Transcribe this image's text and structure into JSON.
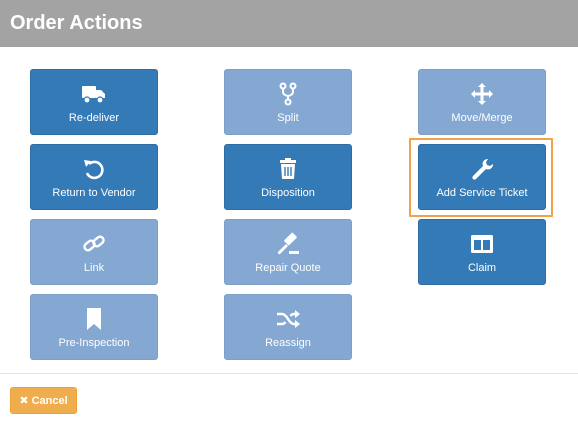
{
  "dialog": {
    "title": "Order Actions"
  },
  "colors": {
    "primary": "#337ab7",
    "primary_disabled": "#84a8d1",
    "warning": "#f0ad4e",
    "highlight": "#f0a24a",
    "header": "#a3a3a3"
  },
  "actions": [
    {
      "label": "Re-deliver",
      "icon": "truck-icon",
      "enabled": true
    },
    {
      "label": "Split",
      "icon": "code-fork-icon",
      "enabled": false
    },
    {
      "label": "Move/Merge",
      "icon": "move-arrows-icon",
      "enabled": false
    },
    {
      "label": "Return to Vendor",
      "icon": "undo-icon",
      "enabled": true
    },
    {
      "label": "Disposition",
      "icon": "trash-icon",
      "enabled": true
    },
    {
      "label": "Add Service Ticket",
      "icon": "wrench-icon",
      "enabled": true,
      "highlighted": true
    },
    {
      "label": "Link",
      "icon": "link-icon",
      "enabled": false
    },
    {
      "label": "Repair Quote",
      "icon": "gavel-icon",
      "enabled": false
    },
    {
      "label": "Claim",
      "icon": "columns-icon",
      "enabled": true
    },
    {
      "label": "Pre-Inspection",
      "icon": "bookmark-icon",
      "enabled": false
    },
    {
      "label": "Reassign",
      "icon": "shuffle-icon",
      "enabled": false
    }
  ],
  "footer": {
    "cancel_label": "Cancel",
    "cancel_icon": "close-icon"
  }
}
